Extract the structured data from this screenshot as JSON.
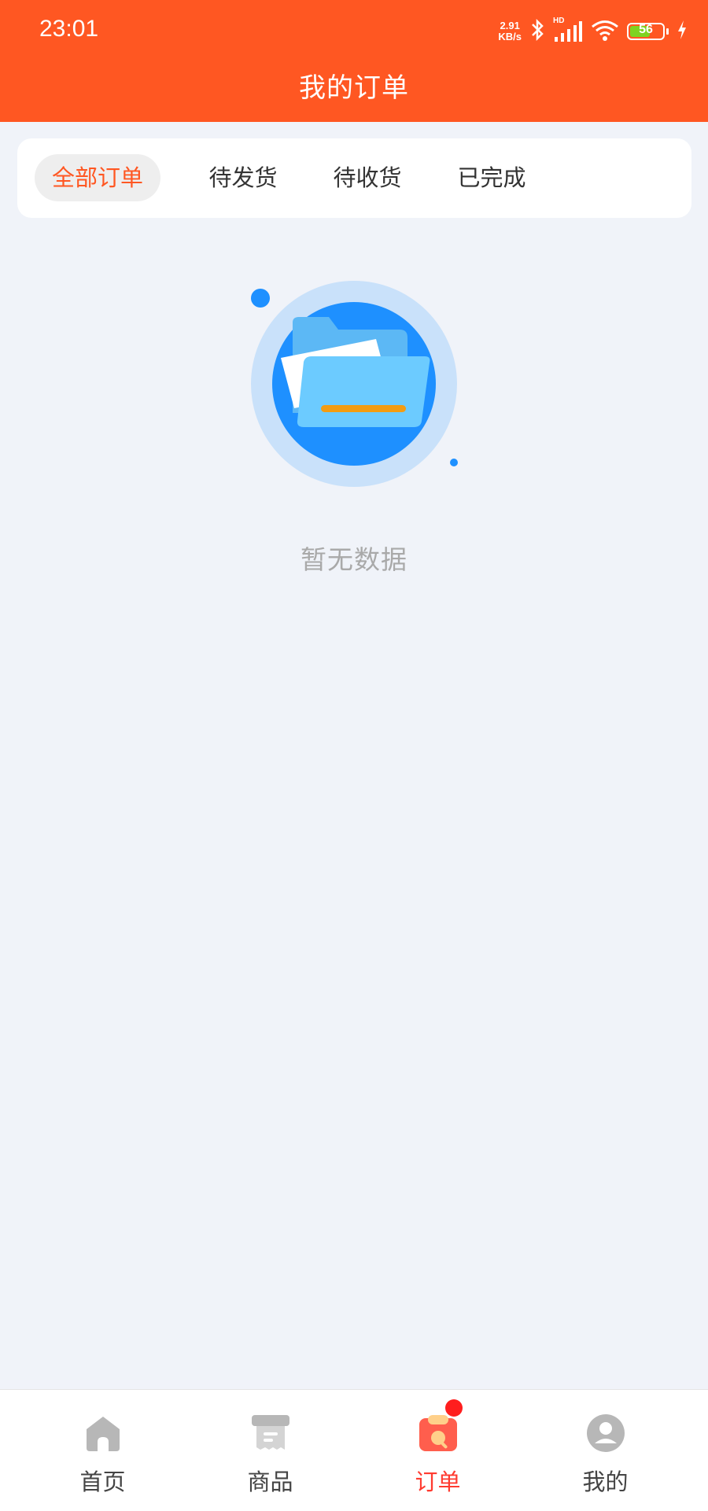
{
  "status_bar": {
    "time": "23:01",
    "net_speed_value": "2.91",
    "net_speed_unit": "KB/s",
    "signal_label": "HD",
    "battery_level": "56",
    "icons": [
      "bluetooth-icon",
      "signal-icon",
      "wifi-icon",
      "battery-icon",
      "charging-icon"
    ]
  },
  "header": {
    "title": "我的订单"
  },
  "tabs": [
    {
      "label": "全部订单",
      "active": true
    },
    {
      "label": "待发货",
      "active": false
    },
    {
      "label": "待收货",
      "active": false
    },
    {
      "label": "已完成",
      "active": false
    }
  ],
  "empty_state": {
    "text": "暂无数据",
    "icon": "empty-folder-illustration"
  },
  "bottom_nav": [
    {
      "label": "首页",
      "icon": "home-icon",
      "active": false
    },
    {
      "label": "商品",
      "icon": "goods-icon",
      "active": false
    },
    {
      "label": "订单",
      "icon": "order-icon",
      "active": true
    },
    {
      "label": "我的",
      "icon": "profile-icon",
      "active": false
    }
  ],
  "colors": {
    "primary": "#ff5722",
    "background": "#f0f3f9",
    "active_nav": "#ff3b30",
    "empty_text": "#a9a9a9"
  }
}
